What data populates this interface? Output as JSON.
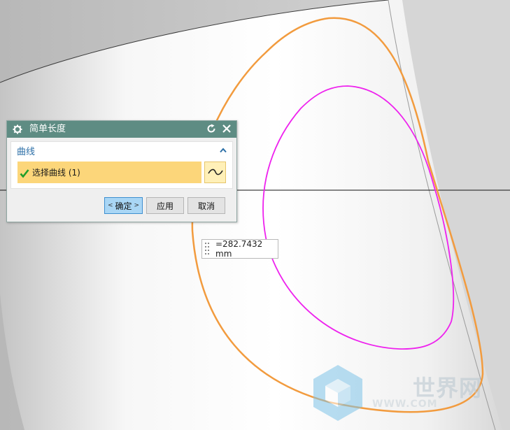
{
  "dialog": {
    "title": "简单长度",
    "group_title": "曲线",
    "selection_label": "选择曲线 (1)",
    "buttons": {
      "ok": "确定",
      "ok_prefix": "<",
      "ok_suffix": ">",
      "apply": "应用",
      "cancel": "取消"
    }
  },
  "measurement": {
    "value": "=282.7432 mm"
  },
  "watermark": {
    "text": "世界网",
    "sub": "WWW.COM"
  },
  "icons": {
    "settings": "gear-icon",
    "reset": "reset-icon",
    "close": "close-icon",
    "collapse": "chevron-up-icon",
    "selected": "checkmark-icon",
    "curve": "curve-icon",
    "grip": "drag-grip-icon"
  },
  "colors": {
    "titlebar": "#5e8c83",
    "selection_highlight": "#fcd67a",
    "ok_button": "#a9d6f5",
    "orange_curve": "#f29b3e",
    "magenta_curve": "#ee22ee",
    "group_title": "#2c6fa7"
  }
}
